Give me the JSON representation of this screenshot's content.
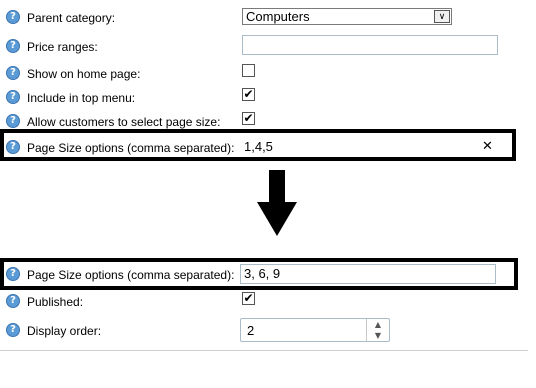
{
  "help_glyph": "?",
  "fields_top": {
    "parent_category": {
      "label": "Parent category:",
      "value": "Computers"
    },
    "price_ranges": {
      "label": "Price ranges:",
      "value": ""
    },
    "show_on_home_page": {
      "label": "Show on home page:",
      "checked": false
    },
    "include_in_top_menu": {
      "label": "Include in top menu:",
      "checked": true
    },
    "allow_page_size": {
      "label": "Allow customers to select page size:",
      "checked": true
    },
    "page_size_options_before": {
      "label": "Page Size options (comma separated):",
      "value": "1,4,5",
      "clear_icon": "✕"
    }
  },
  "arrow_icon": "down-arrow",
  "fields_bottom": {
    "page_size_options_after": {
      "label": "Page Size options (comma separated):",
      "value": "3, 6, 9"
    },
    "published": {
      "label": "Published:",
      "checked": true
    },
    "display_order": {
      "label": "Display order:",
      "value": "2",
      "up": "▲",
      "down": "▼"
    }
  },
  "check_glyph": "✔",
  "select_arrow": "∨"
}
